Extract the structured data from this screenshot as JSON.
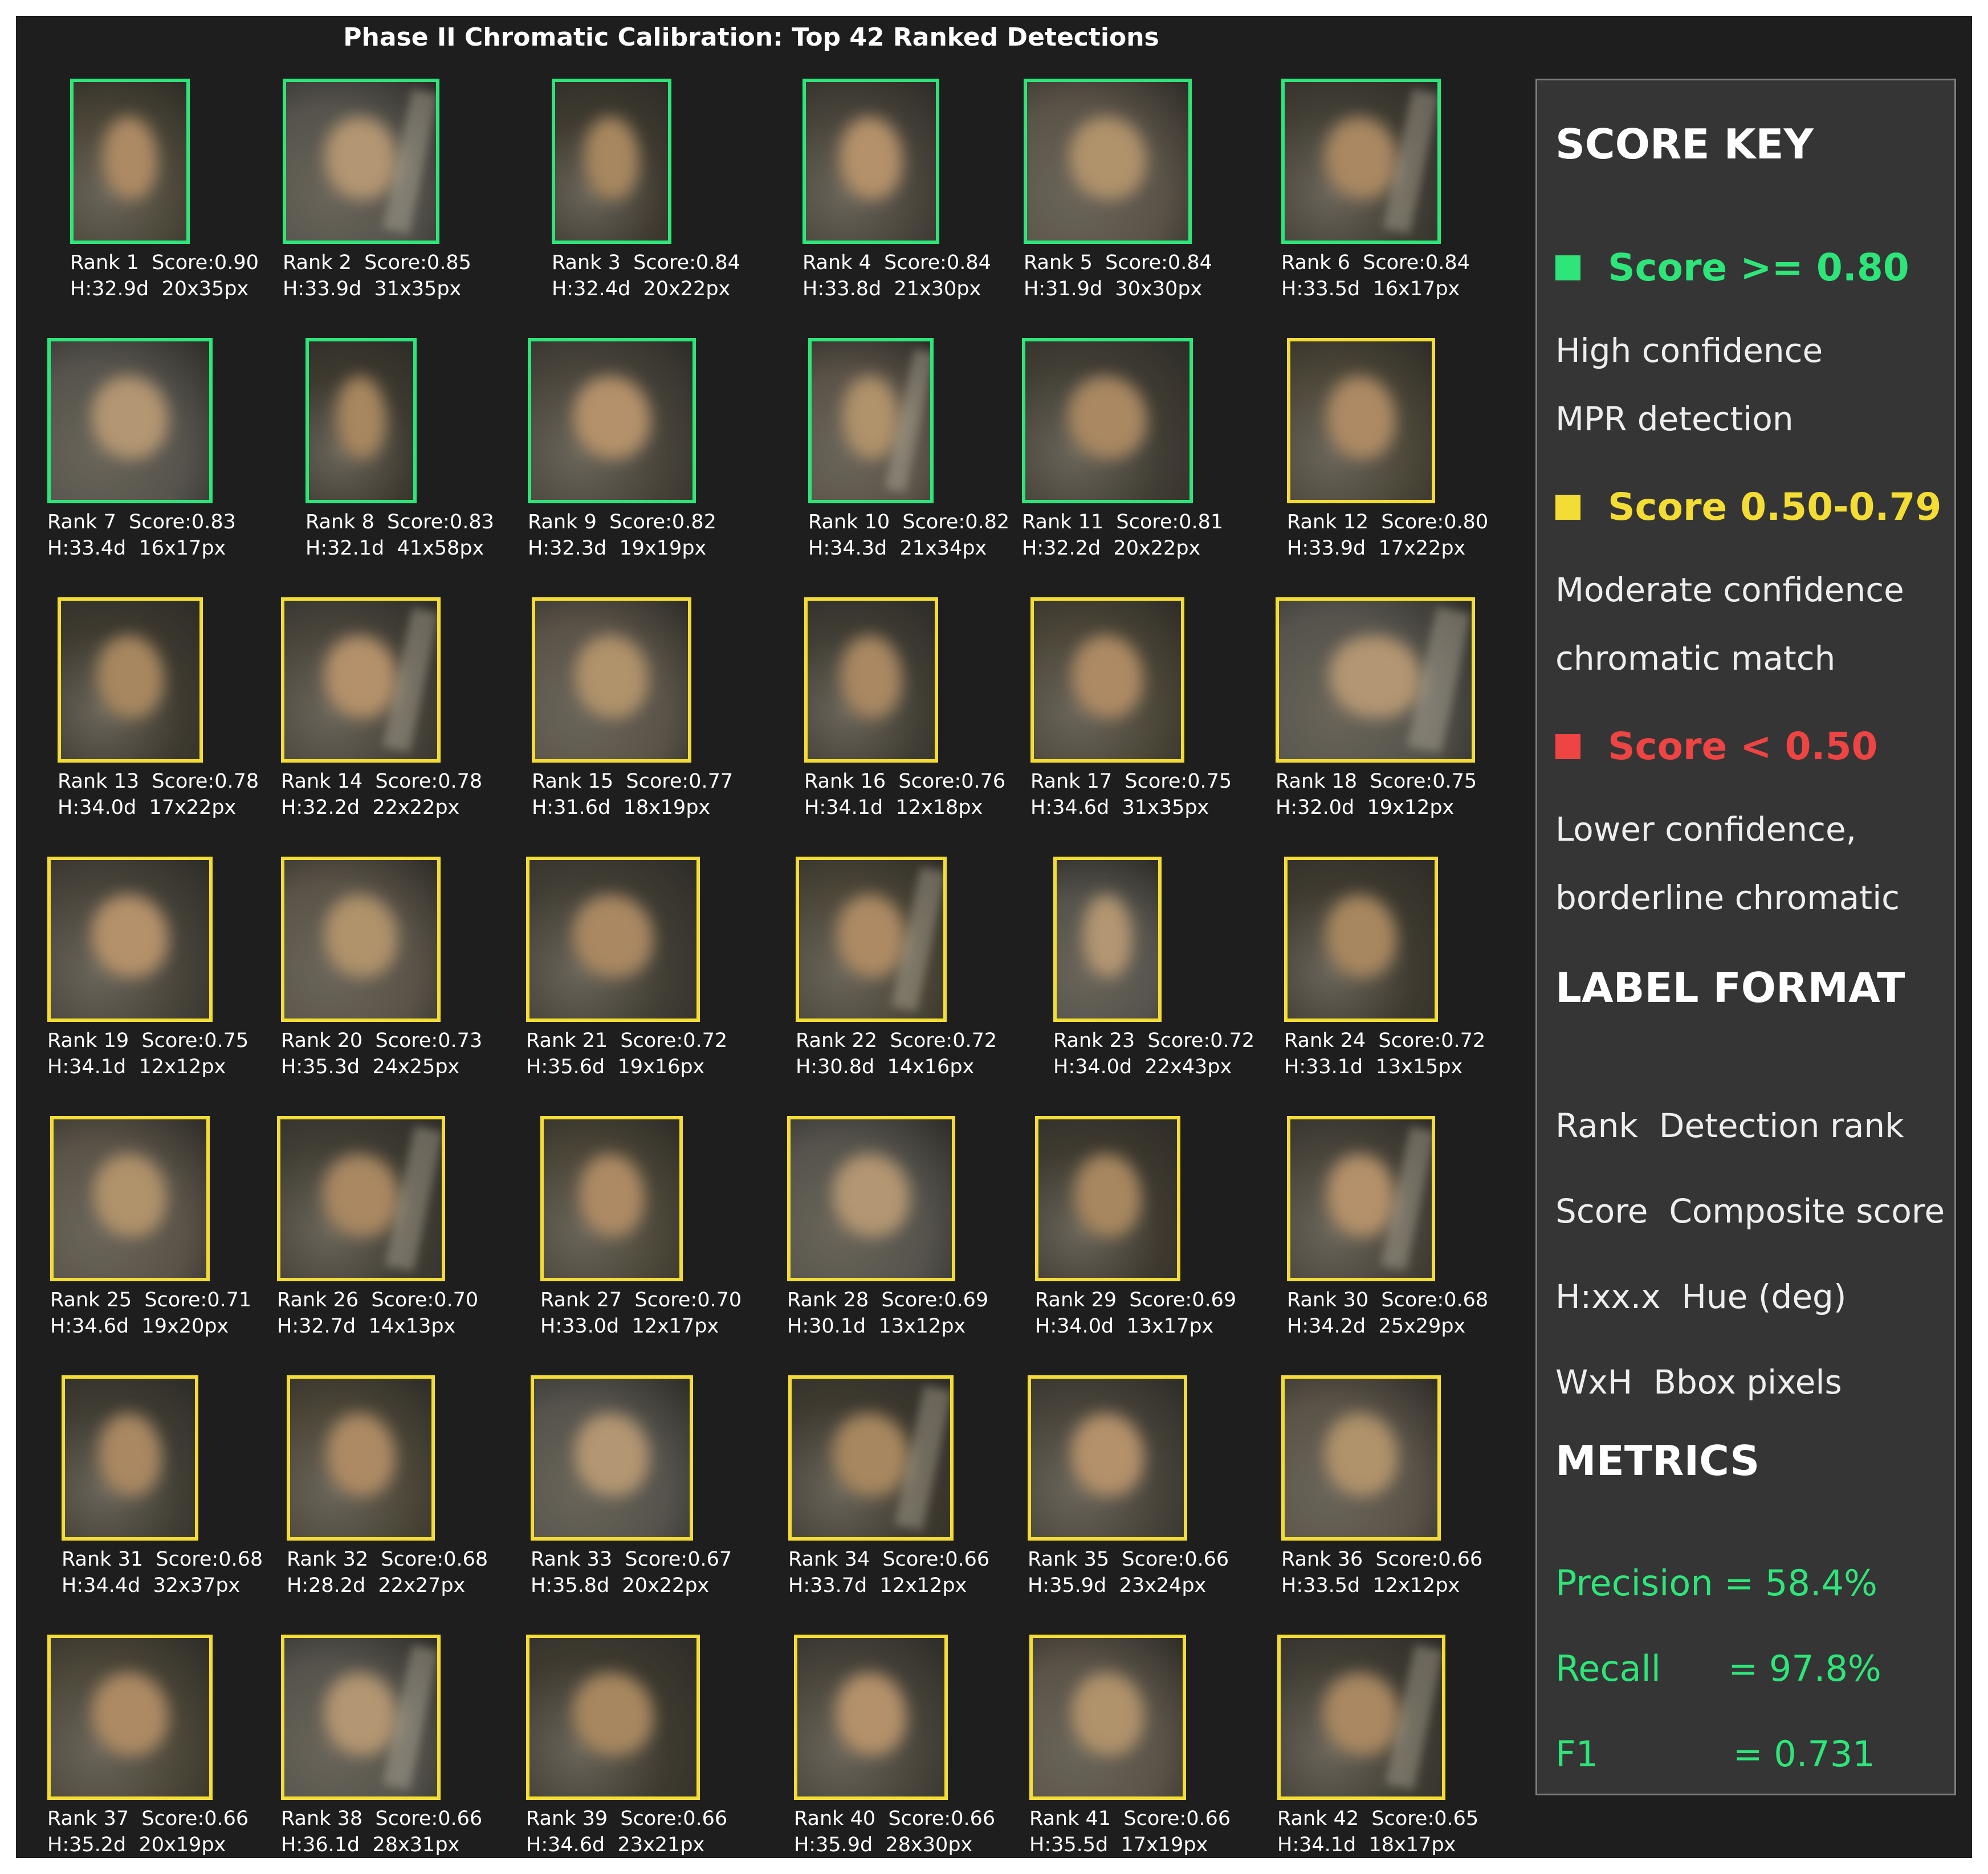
{
  "title": "Phase II Chromatic Calibration: Top 42 Ranked Detections",
  "colors": {
    "high": "#2ee57a",
    "moderate": "#f3dd35",
    "low": "#ee4444",
    "figure_bg": "#1e1e1e",
    "panel_bg": "#353535"
  },
  "detections": [
    {
      "rank_label": "Rank 1",
      "score_label": "Score:0.90",
      "hue_label": "H:32.9d",
      "size_label": "20x35px",
      "tier": "high"
    },
    {
      "rank_label": "Rank 2",
      "score_label": "Score:0.85",
      "hue_label": "H:33.9d",
      "size_label": "31x35px",
      "tier": "high"
    },
    {
      "rank_label": "Rank 3",
      "score_label": "Score:0.84",
      "hue_label": "H:32.4d",
      "size_label": "20x22px",
      "tier": "high"
    },
    {
      "rank_label": "Rank 4",
      "score_label": "Score:0.84",
      "hue_label": "H:33.8d",
      "size_label": "21x30px",
      "tier": "high"
    },
    {
      "rank_label": "Rank 5",
      "score_label": "Score:0.84",
      "hue_label": "H:31.9d",
      "size_label": "30x30px",
      "tier": "high"
    },
    {
      "rank_label": "Rank 6",
      "score_label": "Score:0.84",
      "hue_label": "H:33.5d",
      "size_label": "16x17px",
      "tier": "high"
    },
    {
      "rank_label": "Rank 7",
      "score_label": "Score:0.83",
      "hue_label": "H:33.4d",
      "size_label": "16x17px",
      "tier": "high"
    },
    {
      "rank_label": "Rank 8",
      "score_label": "Score:0.83",
      "hue_label": "H:32.1d",
      "size_label": "41x58px",
      "tier": "high"
    },
    {
      "rank_label": "Rank 9",
      "score_label": "Score:0.82",
      "hue_label": "H:32.3d",
      "size_label": "19x19px",
      "tier": "high"
    },
    {
      "rank_label": "Rank 10",
      "score_label": "Score:0.82",
      "hue_label": "H:34.3d",
      "size_label": "21x34px",
      "tier": "high"
    },
    {
      "rank_label": "Rank 11",
      "score_label": "Score:0.81",
      "hue_label": "H:32.2d",
      "size_label": "20x22px",
      "tier": "high"
    },
    {
      "rank_label": "Rank 12",
      "score_label": "Score:0.80",
      "hue_label": "H:33.9d",
      "size_label": "17x22px",
      "tier": "moderate"
    },
    {
      "rank_label": "Rank 13",
      "score_label": "Score:0.78",
      "hue_label": "H:34.0d",
      "size_label": "17x22px",
      "tier": "moderate"
    },
    {
      "rank_label": "Rank 14",
      "score_label": "Score:0.78",
      "hue_label": "H:32.2d",
      "size_label": "22x22px",
      "tier": "moderate"
    },
    {
      "rank_label": "Rank 15",
      "score_label": "Score:0.77",
      "hue_label": "H:31.6d",
      "size_label": "18x19px",
      "tier": "moderate"
    },
    {
      "rank_label": "Rank 16",
      "score_label": "Score:0.76",
      "hue_label": "H:34.1d",
      "size_label": "12x18px",
      "tier": "moderate"
    },
    {
      "rank_label": "Rank 17",
      "score_label": "Score:0.75",
      "hue_label": "H:34.6d",
      "size_label": "31x35px",
      "tier": "moderate"
    },
    {
      "rank_label": "Rank 18",
      "score_label": "Score:0.75",
      "hue_label": "H:32.0d",
      "size_label": "19x12px",
      "tier": "moderate"
    },
    {
      "rank_label": "Rank 19",
      "score_label": "Score:0.75",
      "hue_label": "H:34.1d",
      "size_label": "12x12px",
      "tier": "moderate"
    },
    {
      "rank_label": "Rank 20",
      "score_label": "Score:0.73",
      "hue_label": "H:35.3d",
      "size_label": "24x25px",
      "tier": "moderate"
    },
    {
      "rank_label": "Rank 21",
      "score_label": "Score:0.72",
      "hue_label": "H:35.6d",
      "size_label": "19x16px",
      "tier": "moderate"
    },
    {
      "rank_label": "Rank 22",
      "score_label": "Score:0.72",
      "hue_label": "H:30.8d",
      "size_label": "14x16px",
      "tier": "moderate"
    },
    {
      "rank_label": "Rank 23",
      "score_label": "Score:0.72",
      "hue_label": "H:34.0d",
      "size_label": "22x43px",
      "tier": "moderate"
    },
    {
      "rank_label": "Rank 24",
      "score_label": "Score:0.72",
      "hue_label": "H:33.1d",
      "size_label": "13x15px",
      "tier": "moderate"
    },
    {
      "rank_label": "Rank 25",
      "score_label": "Score:0.71",
      "hue_label": "H:34.6d",
      "size_label": "19x20px",
      "tier": "moderate"
    },
    {
      "rank_label": "Rank 26",
      "score_label": "Score:0.70",
      "hue_label": "H:32.7d",
      "size_label": "14x13px",
      "tier": "moderate"
    },
    {
      "rank_label": "Rank 27",
      "score_label": "Score:0.70",
      "hue_label": "H:33.0d",
      "size_label": "12x17px",
      "tier": "moderate"
    },
    {
      "rank_label": "Rank 28",
      "score_label": "Score:0.69",
      "hue_label": "H:30.1d",
      "size_label": "13x12px",
      "tier": "moderate"
    },
    {
      "rank_label": "Rank 29",
      "score_label": "Score:0.69",
      "hue_label": "H:34.0d",
      "size_label": "13x17px",
      "tier": "moderate"
    },
    {
      "rank_label": "Rank 30",
      "score_label": "Score:0.68",
      "hue_label": "H:34.2d",
      "size_label": "25x29px",
      "tier": "moderate"
    },
    {
      "rank_label": "Rank 31",
      "score_label": "Score:0.68",
      "hue_label": "H:34.4d",
      "size_label": "32x37px",
      "tier": "moderate"
    },
    {
      "rank_label": "Rank 32",
      "score_label": "Score:0.68",
      "hue_label": "H:28.2d",
      "size_label": "22x27px",
      "tier": "moderate"
    },
    {
      "rank_label": "Rank 33",
      "score_label": "Score:0.67",
      "hue_label": "H:35.8d",
      "size_label": "20x22px",
      "tier": "moderate"
    },
    {
      "rank_label": "Rank 34",
      "score_label": "Score:0.66",
      "hue_label": "H:33.7d",
      "size_label": "12x12px",
      "tier": "moderate"
    },
    {
      "rank_label": "Rank 35",
      "score_label": "Score:0.66",
      "hue_label": "H:35.9d",
      "size_label": "23x24px",
      "tier": "moderate"
    },
    {
      "rank_label": "Rank 36",
      "score_label": "Score:0.66",
      "hue_label": "H:33.5d",
      "size_label": "12x12px",
      "tier": "moderate"
    },
    {
      "rank_label": "Rank 37",
      "score_label": "Score:0.66",
      "hue_label": "H:35.2d",
      "size_label": "20x19px",
      "tier": "moderate"
    },
    {
      "rank_label": "Rank 38",
      "score_label": "Score:0.66",
      "hue_label": "H:36.1d",
      "size_label": "28x31px",
      "tier": "moderate"
    },
    {
      "rank_label": "Rank 39",
      "score_label": "Score:0.66",
      "hue_label": "H:34.6d",
      "size_label": "23x21px",
      "tier": "moderate"
    },
    {
      "rank_label": "Rank 40",
      "score_label": "Score:0.66",
      "hue_label": "H:35.9d",
      "size_label": "28x30px",
      "tier": "moderate"
    },
    {
      "rank_label": "Rank 41",
      "score_label": "Score:0.66",
      "hue_label": "H:35.5d",
      "size_label": "17x19px",
      "tier": "moderate"
    },
    {
      "rank_label": "Rank 42",
      "score_label": "Score:0.65",
      "hue_label": "H:34.1d",
      "size_label": "18x17px",
      "tier": "moderate"
    }
  ],
  "key": {
    "score_key_title": "SCORE KEY",
    "tiers": [
      {
        "label": "Score >= 0.80",
        "color": "#2ee57a",
        "desc": [
          "High confidence",
          "MPR detection"
        ]
      },
      {
        "label": "Score 0.50-0.79",
        "color": "#f3dd35",
        "desc": [
          "Moderate confidence",
          "chromatic match"
        ]
      },
      {
        "label": "Score < 0.50",
        "color": "#ee4444",
        "desc": [
          "Lower confidence,",
          "borderline chromatic"
        ]
      }
    ],
    "label_format_title": "LABEL FORMAT",
    "label_format": [
      "Rank  Detection rank",
      "Score  Composite score",
      "H:xx.x  Hue (deg)",
      "WxH  Bbox pixels"
    ],
    "metrics_title": "METRICS",
    "metrics": [
      "Precision = 58.4%",
      "Recall      = 97.8%",
      "F1            = 0.731"
    ]
  }
}
